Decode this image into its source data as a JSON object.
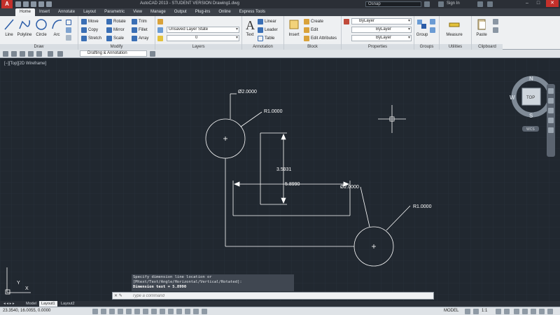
{
  "titlebar": {
    "title": "AutoCAD 2013 - STUDENT VERSION    Drawing1.dwg",
    "search": "Osnap",
    "signin": "Sign In"
  },
  "tabs": [
    "Home",
    "Insert",
    "Annotate",
    "Layout",
    "Parametric",
    "View",
    "Manage",
    "Output",
    "Plug-ins",
    "Online",
    "Express Tools"
  ],
  "ribbon": {
    "draw": {
      "title": "Draw",
      "tools": [
        "Line",
        "Polyline",
        "Circle",
        "Arc"
      ]
    },
    "modify": {
      "title": "Modify",
      "tools": [
        "Move",
        "Rotate",
        "Trim",
        "Copy",
        "Mirror",
        "Fillet",
        "Stretch",
        "Scale",
        "Array"
      ]
    },
    "layers": {
      "title": "Layers",
      "layer_state": "Unsaved Layer State",
      "current_layer": "0"
    },
    "annotation": {
      "title": "Annotation",
      "text": "Text",
      "linear": "Linear",
      "leader": "Leader",
      "table": "Table"
    },
    "block": {
      "title": "Block",
      "insert": "Insert",
      "create": "Create",
      "edit": "Edit",
      "edit_attributes": "Edit Attributes"
    },
    "properties": {
      "title": "Properties",
      "color": "ByLayer",
      "linetype": "ByLayer",
      "lineweight": "ByLayer"
    },
    "groups": {
      "title": "Groups",
      "group": "Group"
    },
    "utilities": {
      "title": "Utilities",
      "measure": "Measure"
    },
    "clipboard": {
      "title": "Clipboard",
      "paste": "Paste"
    }
  },
  "workspace": "Drafting & Annotation",
  "viewport_label": "[−][Top][2D Wireframe]",
  "viewcube": {
    "top": "TOP",
    "n": "N",
    "s": "S",
    "e": "E",
    "w": "W",
    "wcs": "WCS"
  },
  "drawing": {
    "annotations": [
      "Ø2.0000",
      "R1.0000",
      "3.5931",
      "5.8990",
      "Ø2.0000",
      "R1.0000"
    ]
  },
  "command": {
    "history": [
      "Specify dimension line location or",
      "[Mtext/Text/Angle/Horizontal/Vertical/Rotated]:",
      "Dimension text = 5.8990"
    ],
    "placeholder": "Type a command"
  },
  "layout_tabs": [
    "Model",
    "Layout1",
    "Layout2"
  ],
  "status": {
    "coords": "23.3540, 16.0055, 0.0000",
    "model": "MODEL",
    "scale": "1:1"
  },
  "colors": {
    "background": "#212830",
    "drawing_lines": "#ffffff",
    "titlebar": "#2b2f36",
    "ribbon": "#eef0f2"
  }
}
